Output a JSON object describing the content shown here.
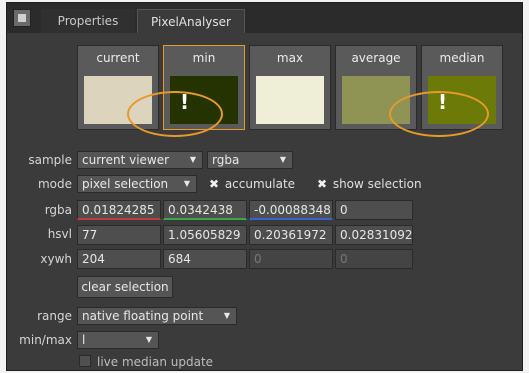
{
  "tabs": [
    "Properties",
    "PixelAnalyser"
  ],
  "swatches": [
    {
      "label": "current",
      "color": "#dcd4bc"
    },
    {
      "label": "min",
      "color": "#243300",
      "warning": "!"
    },
    {
      "label": "max",
      "color": "#efefd8"
    },
    {
      "label": "average",
      "color": "#8f9454"
    },
    {
      "label": "median",
      "color": "#6c7a08",
      "warning": "!"
    }
  ],
  "sample": {
    "label": "sample",
    "source": "current viewer",
    "channels": "rgba"
  },
  "mode": {
    "label": "mode",
    "value": "pixel selection",
    "accumulate": "accumulate",
    "show_selection": "show selection"
  },
  "rgba": {
    "label": "rgba",
    "values": [
      "0.01824285",
      "0.0342438",
      "-0.00088348",
      "0"
    ]
  },
  "hsvl": {
    "label": "hsvl",
    "values": [
      "77",
      "1.05605829",
      "0.20361972",
      "0.02831092"
    ]
  },
  "xywh": {
    "label": "xywh",
    "values": [
      "204",
      "684",
      "0",
      "0"
    ]
  },
  "clear_selection": "clear selection",
  "range": {
    "label": "range",
    "value": "native floating point"
  },
  "minmax": {
    "label": "min/max",
    "value": "l"
  },
  "live_median": "live median update",
  "colors": {
    "accent": "#e89a28",
    "panel": "#3b3b3b"
  }
}
